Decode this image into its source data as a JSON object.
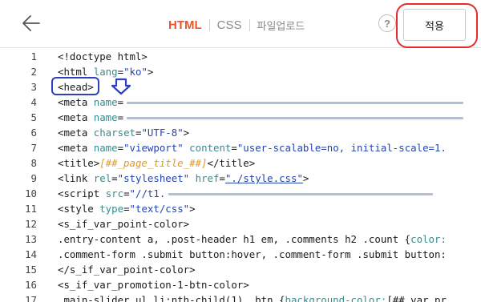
{
  "toolbar": {
    "tabs": [
      "HTML",
      "CSS",
      "파일업로드"
    ],
    "help_label": "?",
    "apply_label": "적용"
  },
  "editor": {
    "lines": [
      {
        "n": "1",
        "parts": [
          [
            "t",
            "<!doctype html>"
          ]
        ]
      },
      {
        "n": "2",
        "parts": [
          [
            "t",
            "<html "
          ],
          [
            "a",
            "lang"
          ],
          [
            "t",
            "="
          ],
          [
            "s",
            "\"ko\""
          ],
          [
            "t",
            ">"
          ]
        ]
      },
      {
        "n": "3",
        "parts": [
          [
            "t",
            "<head>"
          ]
        ]
      },
      {
        "n": "4",
        "parts": [
          [
            "t",
            "<meta "
          ],
          [
            "a",
            "name"
          ],
          [
            "t",
            "="
          ],
          [
            "blur",
            "420"
          ]
        ]
      },
      {
        "n": "5",
        "parts": [
          [
            "t",
            "<meta "
          ],
          [
            "a",
            "name"
          ],
          [
            "t",
            "="
          ],
          [
            "blur",
            "420"
          ]
        ]
      },
      {
        "n": "6",
        "parts": [
          [
            "t",
            "<meta "
          ],
          [
            "a",
            "charset"
          ],
          [
            "t",
            "="
          ],
          [
            "s",
            "\"UTF-8\""
          ],
          [
            "t",
            ">"
          ]
        ]
      },
      {
        "n": "7",
        "parts": [
          [
            "t",
            "<meta "
          ],
          [
            "a",
            "name"
          ],
          [
            "t",
            "="
          ],
          [
            "s",
            "\"viewport\""
          ],
          [
            "t",
            " "
          ],
          [
            "a",
            "content"
          ],
          [
            "t",
            "="
          ],
          [
            "s",
            "\"user-scalable=no, initial-scale=1."
          ]
        ]
      },
      {
        "n": "8",
        "parts": [
          [
            "t",
            "<title>"
          ],
          [
            "ph",
            "[##_page_title_##]"
          ],
          [
            "t",
            "</title>"
          ]
        ]
      },
      {
        "n": "9",
        "parts": [
          [
            "t",
            "<link "
          ],
          [
            "a",
            "rel"
          ],
          [
            "t",
            "="
          ],
          [
            "s",
            "\"stylesheet\""
          ],
          [
            "t",
            " "
          ],
          [
            "a",
            "href"
          ],
          [
            "t",
            "="
          ],
          [
            "st",
            "\"./style.css\""
          ],
          [
            "t",
            ">"
          ]
        ]
      },
      {
        "n": "10",
        "parts": [
          [
            "t",
            "<script "
          ],
          [
            "a",
            "src"
          ],
          [
            "t",
            "="
          ],
          [
            "s",
            "\"//t1."
          ],
          [
            "blur",
            "330"
          ]
        ]
      },
      {
        "n": "11",
        "parts": [
          [
            "t",
            "<style "
          ],
          [
            "a",
            "type"
          ],
          [
            "t",
            "="
          ],
          [
            "s",
            "\"text/css\""
          ],
          [
            "t",
            ">"
          ]
        ]
      },
      {
        "n": "12",
        "parts": [
          [
            "t",
            "<s_if_var_point-color>"
          ]
        ]
      },
      {
        "n": "13",
        "parts": [
          [
            "t",
            ".entry-content a, .post-header h1 em, .comments h2 .count {"
          ],
          [
            "a",
            "color:"
          ]
        ]
      },
      {
        "n": "14",
        "parts": [
          [
            "t",
            ".comment-form .submit button:hover, .comment-form .submit button:"
          ]
        ]
      },
      {
        "n": "15",
        "parts": [
          [
            "t",
            "</s_if_var_point-color>"
          ]
        ]
      },
      {
        "n": "16",
        "parts": [
          [
            "t",
            "<s_if_var_promotion-1-btn-color>"
          ]
        ]
      },
      {
        "n": "17",
        "parts": [
          [
            "t",
            ".main-slider ul li:nth-child(1) .btn {"
          ],
          [
            "a",
            "background-color:"
          ],
          [
            "t",
            "[## var pr"
          ]
        ]
      }
    ]
  }
}
